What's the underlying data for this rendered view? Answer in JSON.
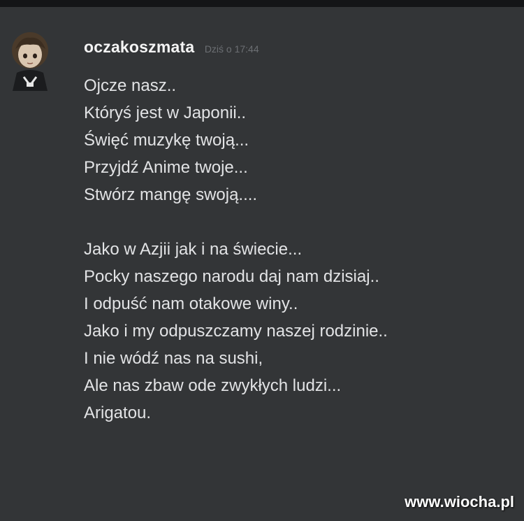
{
  "message": {
    "username": "oczakoszmata",
    "timestamp": "Dziś o 17:44",
    "avatar_icon": "anime-character-avatar-icon",
    "lines": [
      "Ojcze nasz..",
      "Któryś jest w Japonii..",
      "Święć muzykę twoją...",
      "Przyjdź Anime twoje...",
      "Stwórz mangę swoją....",
      "",
      "Jako w Azjii jak i na świecie...",
      "Pocky naszego narodu daj nam dzisiaj..",
      "I odpuść nam otakowe winy..",
      "Jako i my odpuszczamy naszej rodzinie..",
      "I nie wódź nas na sushi,",
      "Ale nas zbaw ode zwykłych ludzi...",
      "Arigatou."
    ]
  },
  "watermark": "www.wiocha.pl",
  "colors": {
    "background": "#333537",
    "username": "#f4f4f4",
    "text": "#e2e3e5",
    "timestamp": "#6c6f73"
  }
}
